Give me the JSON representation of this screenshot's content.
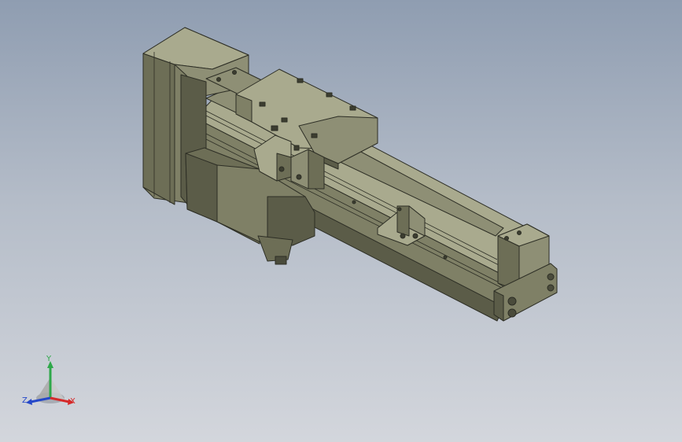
{
  "window": {
    "type": "cad-model-viewport",
    "background_top": "#8f9db1",
    "background_bottom": "#d3d6dc"
  },
  "model": {
    "body_color": "#7f8066",
    "body_highlight": "#a9aa8e",
    "body_shadow": "#5b5c48",
    "edge_color": "#2d2e25"
  },
  "triad": {
    "y_label": "Y",
    "z_label": "Z",
    "x_label": "X",
    "y_color": "#2ea84a",
    "z_color": "#2548c9",
    "x_color": "#d52a2a"
  }
}
